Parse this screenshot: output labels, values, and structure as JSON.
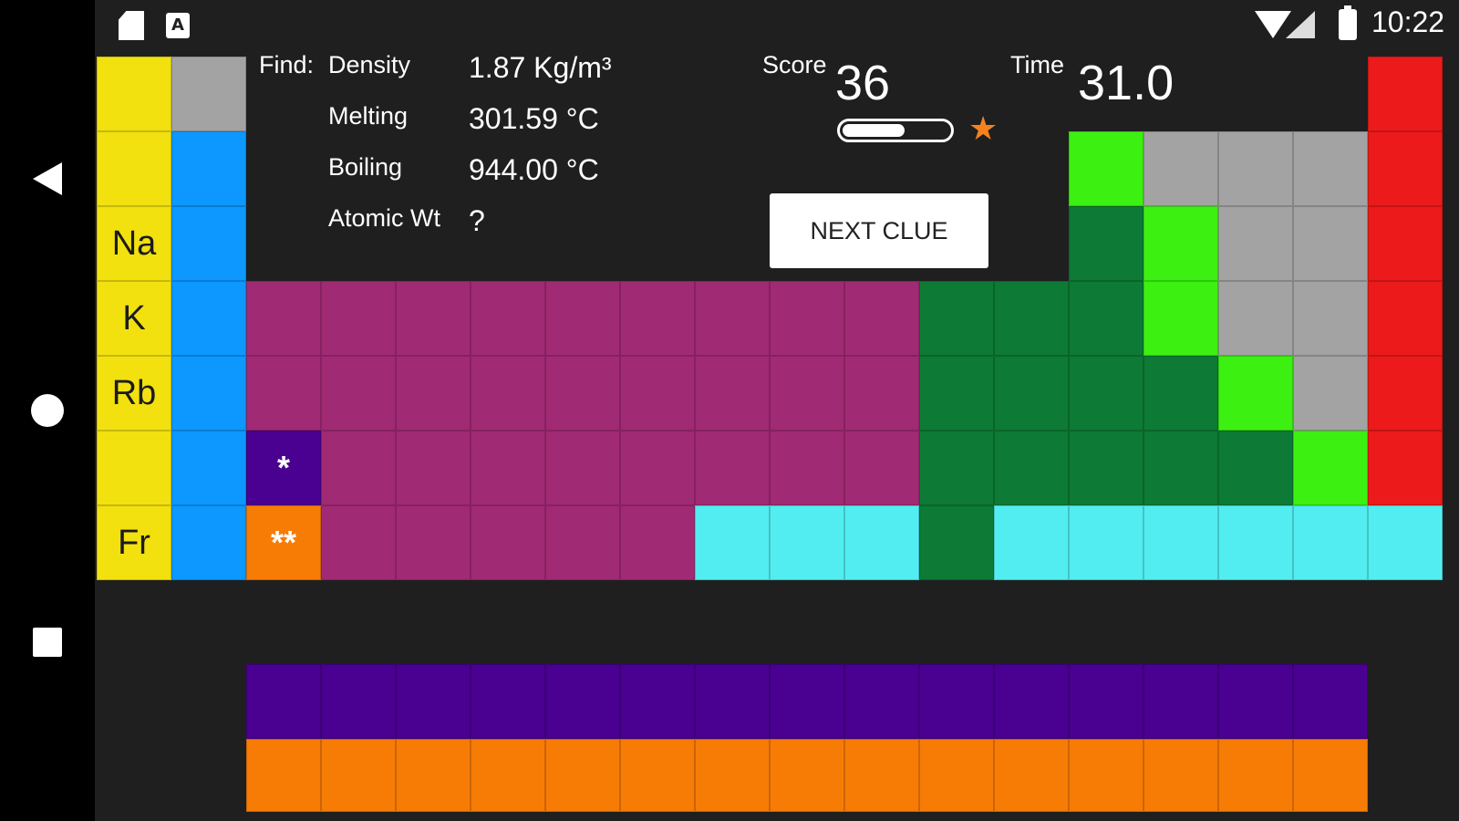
{
  "status_bar": {
    "time": "10:22",
    "icons": [
      "sd-card-icon",
      "a-icon",
      "wifi-icon",
      "signal-icon",
      "battery-icon"
    ],
    "a_icon_text": "A"
  },
  "nav_bar": {
    "icons": [
      "back-icon",
      "home-icon",
      "recents-icon"
    ]
  },
  "clues": {
    "find_label": "Find:",
    "rows": [
      {
        "label": "Density",
        "value": "1.87 Kg/m³"
      },
      {
        "label": "Melting",
        "value": "301.59 °C"
      },
      {
        "label": "Boiling",
        "value": "944.00 °C"
      },
      {
        "label": "Atomic Wt",
        "value": "?"
      }
    ]
  },
  "score": {
    "label": "Score",
    "value": "36",
    "progress": 0.6
  },
  "time": {
    "label": "Time",
    "value": "31.0"
  },
  "next_clue_label": "NEXT CLUE",
  "star_icon": "★",
  "colors": {
    "alkali": "#f2e10f",
    "alkaline_earth": "#0c98ff",
    "transition": "#a12a74",
    "lanthanide_marker": "#4a0090",
    "actinide_marker": "#f77c05",
    "post_transition": "#0d7a35",
    "metalloid": "#3cf111",
    "nonmetal": "#a3a3a3",
    "noble_gas": "#ec1a1a",
    "unknown": "#52edf1",
    "background": "#1f1f1f"
  },
  "table": {
    "main_rows": [
      [
        "alkali",
        "nonmetal",
        "",
        "",
        "",
        "",
        "",
        "",
        "",
        "",
        "",
        "",
        "",
        "",
        "",
        "",
        "",
        "noble_gas"
      ],
      [
        "alkali",
        "alkaline_earth",
        "",
        "",
        "",
        "",
        "",
        "",
        "",
        "",
        "",
        "",
        "",
        "metalloid",
        "nonmetal",
        "nonmetal",
        "nonmetal",
        "noble_gas"
      ],
      [
        "alkali",
        "alkaline_earth",
        "",
        "",
        "",
        "",
        "",
        "",
        "",
        "",
        "",
        "",
        "",
        "post_transition",
        "metalloid",
        "nonmetal",
        "nonmetal",
        "noble_gas"
      ],
      [
        "alkali",
        "alkaline_earth",
        "transition",
        "transition",
        "transition",
        "transition",
        "transition",
        "transition",
        "transition",
        "transition",
        "transition",
        "post_transition",
        "post_transition",
        "post_transition",
        "metalloid",
        "nonmetal",
        "nonmetal",
        "noble_gas"
      ],
      [
        "alkali",
        "alkaline_earth",
        "transition",
        "transition",
        "transition",
        "transition",
        "transition",
        "transition",
        "transition",
        "transition",
        "transition",
        "post_transition",
        "post_transition",
        "post_transition",
        "post_transition",
        "metalloid",
        "nonmetal",
        "noble_gas"
      ],
      [
        "alkali",
        "alkaline_earth",
        "lanthanide_marker",
        "transition",
        "transition",
        "transition",
        "transition",
        "transition",
        "transition",
        "transition",
        "transition",
        "post_transition",
        "post_transition",
        "post_transition",
        "post_transition",
        "post_transition",
        "metalloid",
        "noble_gas"
      ],
      [
        "alkali",
        "alkaline_earth",
        "actinide_marker",
        "transition",
        "transition",
        "transition",
        "transition",
        "transition",
        "unknown",
        "unknown",
        "unknown",
        "post_transition",
        "unknown",
        "unknown",
        "unknown",
        "unknown",
        "unknown",
        "unknown"
      ]
    ],
    "symbols": {
      "2-0": "Na",
      "3-0": "K",
      "4-0": "Rb",
      "6-0": "Fr"
    },
    "markers": {
      "5-2": "*",
      "6-2": "**"
    },
    "lanthanide_row_count": 15,
    "actinide_row_count": 15
  }
}
